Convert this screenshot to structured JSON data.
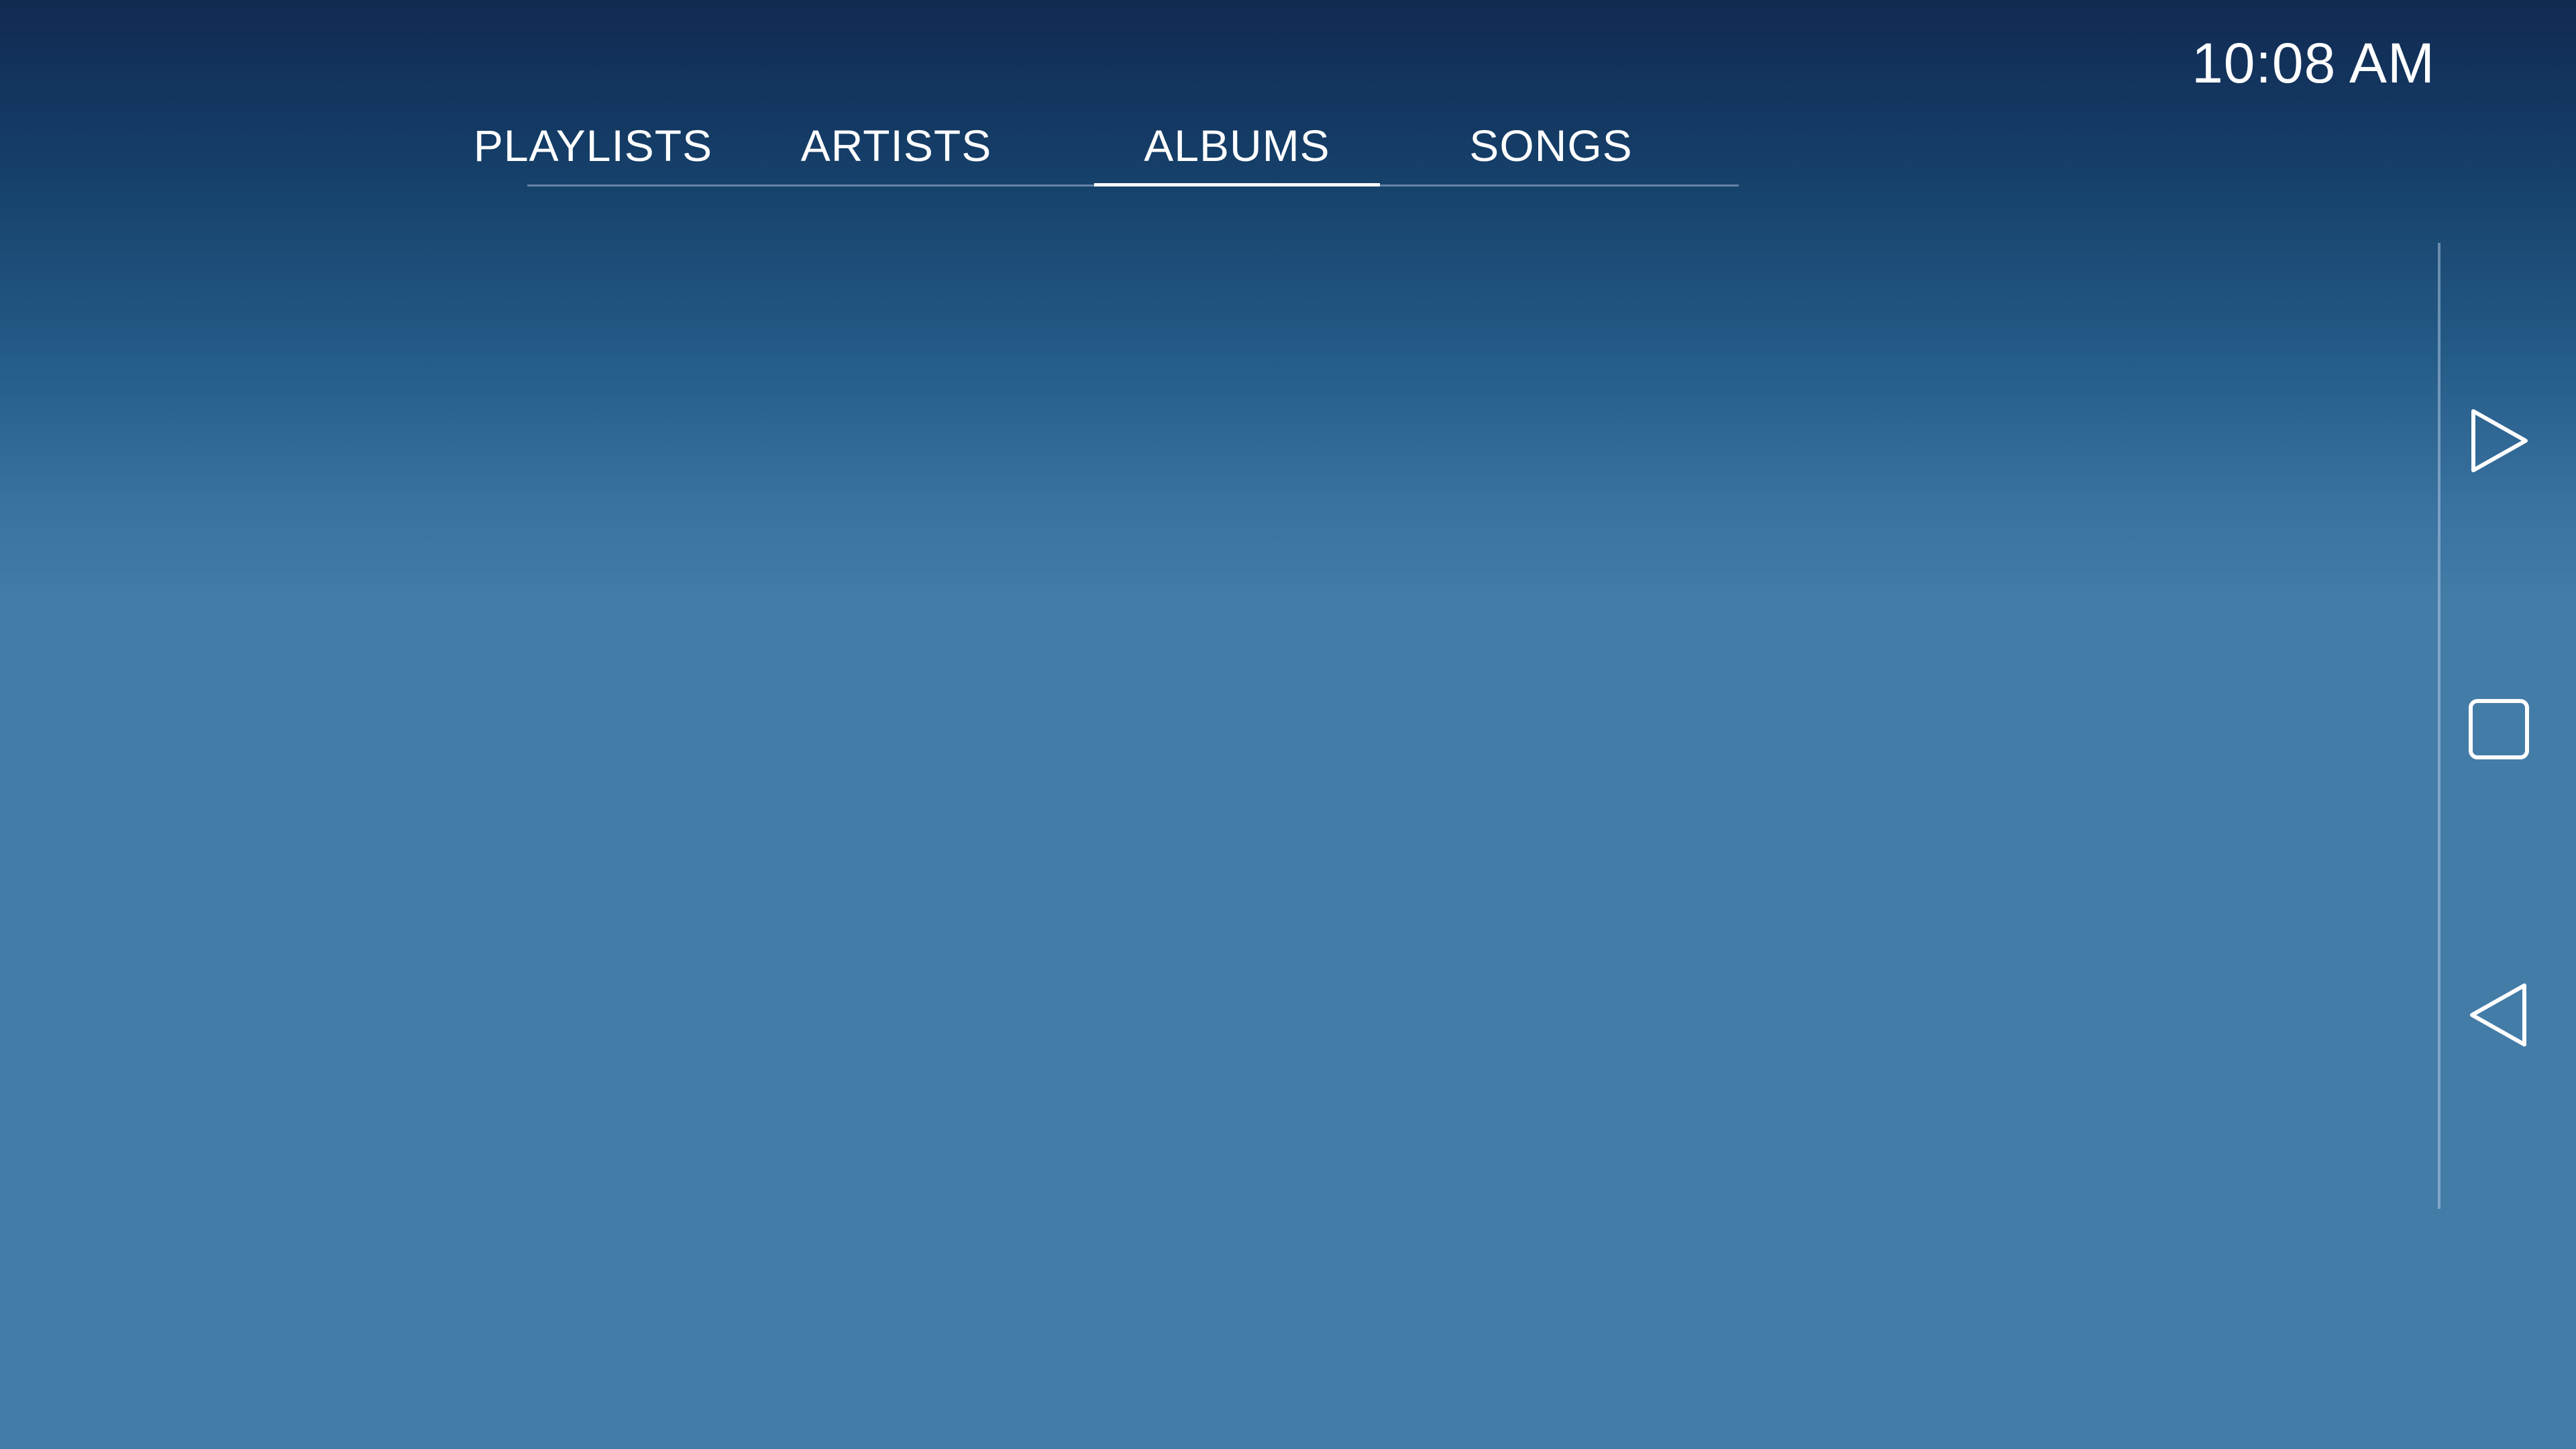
{
  "status_bar": {
    "time": "10:08 AM"
  },
  "tabs": [
    {
      "label": "PLAYLISTS",
      "active": false
    },
    {
      "label": "ARTISTS",
      "active": false
    },
    {
      "label": "ALBUMS",
      "active": true
    },
    {
      "label": "SONGS",
      "active": false
    }
  ],
  "nav_bar": {
    "buttons": [
      {
        "icon": "play-icon"
      },
      {
        "icon": "square-icon"
      },
      {
        "icon": "back-triangle-icon"
      }
    ]
  },
  "colors": {
    "background_top": "#112a52",
    "background_bottom": "#447ca8",
    "text": "#ffffff",
    "active_indicator": "#ffffff"
  }
}
